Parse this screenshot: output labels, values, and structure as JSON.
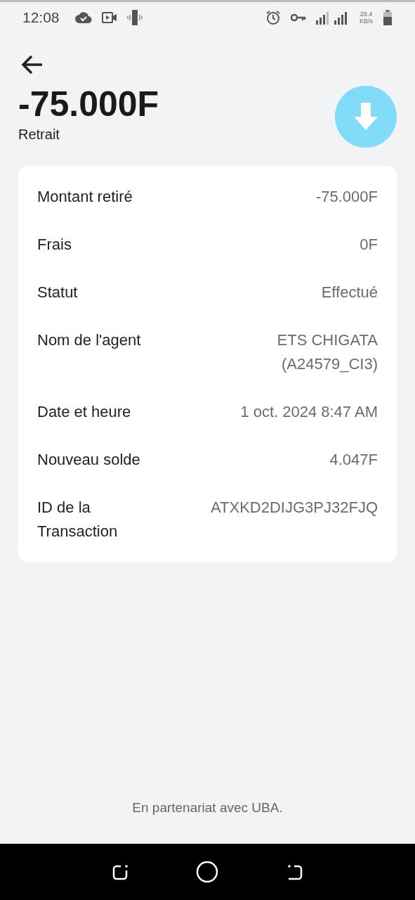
{
  "status_bar": {
    "time": "12:08",
    "speed_value": "28.4",
    "speed_unit": "KB/s"
  },
  "header": {
    "amount": "-75.000F",
    "type": "Retrait"
  },
  "details": [
    {
      "label": "Montant retiré",
      "value": "-75.000F"
    },
    {
      "label": "Frais",
      "value": "0F"
    },
    {
      "label": "Statut",
      "value": "Effectué"
    },
    {
      "label": "Nom de l'agent",
      "value": "ETS CHIGATA (A24579_CI3)"
    },
    {
      "label": "Date et heure",
      "value": "1 oct. 2024 8:47 AM"
    },
    {
      "label": "Nouveau solde",
      "value": "4.047F"
    },
    {
      "label": "ID de la Transaction",
      "value": "ATXKD2DIJG3PJ32FJQ"
    }
  ],
  "footer": "En partenariat avec UBA."
}
